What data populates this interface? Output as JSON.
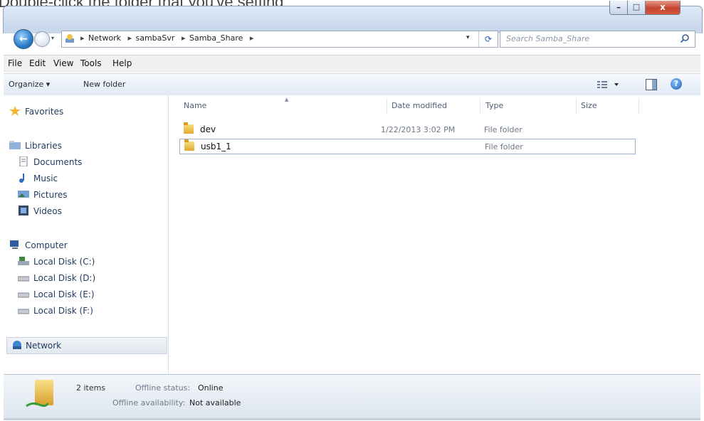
{
  "title_fragment": "Double-click the folder that you've setting",
  "address": {
    "crumbs": [
      "Network",
      "sambaSvr",
      "Samba_Share"
    ],
    "dropdown_glyph": "▾",
    "refresh_glyph": "⟳"
  },
  "search": {
    "placeholder": "Search Samba_Share"
  },
  "window_buttons": {
    "minimize": "–",
    "maximize": "□",
    "close": "x"
  },
  "menu": [
    "File",
    "Edit",
    "View",
    "Tools",
    "Help"
  ],
  "toolbar": {
    "organize": "Organize ▾",
    "new_folder": "New folder",
    "help": "?"
  },
  "nav": {
    "favorites": "Favorites",
    "libraries": "Libraries",
    "documents": "Documents",
    "music": "Music",
    "pictures": "Pictures",
    "videos": "Videos",
    "computer": "Computer",
    "disk_c": "Local Disk (C:)",
    "disk_d": "Local Disk (D:)",
    "disk_e": "Local Disk (E:)",
    "disk_f": "Local Disk (F:)",
    "network": "Network"
  },
  "columns": [
    "Name",
    "Date modified",
    "Type",
    "Size"
  ],
  "files": [
    {
      "name": "dev",
      "date": "1/22/2013 3:02 PM",
      "type": "File folder"
    },
    {
      "name": "usb1_1",
      "date": "",
      "type": "File folder"
    }
  ],
  "status": {
    "count": "2 items",
    "offline_status_label": "Offline status:",
    "offline_status_value": "Online",
    "offline_availability_label": "Offline availability:",
    "offline_availability_value": "Not available"
  },
  "colors": {
    "accent": "#2d7cc7",
    "folder": "#e0a92f",
    "chrome": "#cddcee"
  },
  "icons": [
    "back-arrow-icon",
    "forward-arrow-icon",
    "network-icon",
    "search-icon",
    "folder-icon",
    "star-icon",
    "library-icon",
    "document-icon",
    "music-icon",
    "picture-icon",
    "video-icon",
    "computer-icon",
    "disk-icon",
    "help-icon"
  ]
}
